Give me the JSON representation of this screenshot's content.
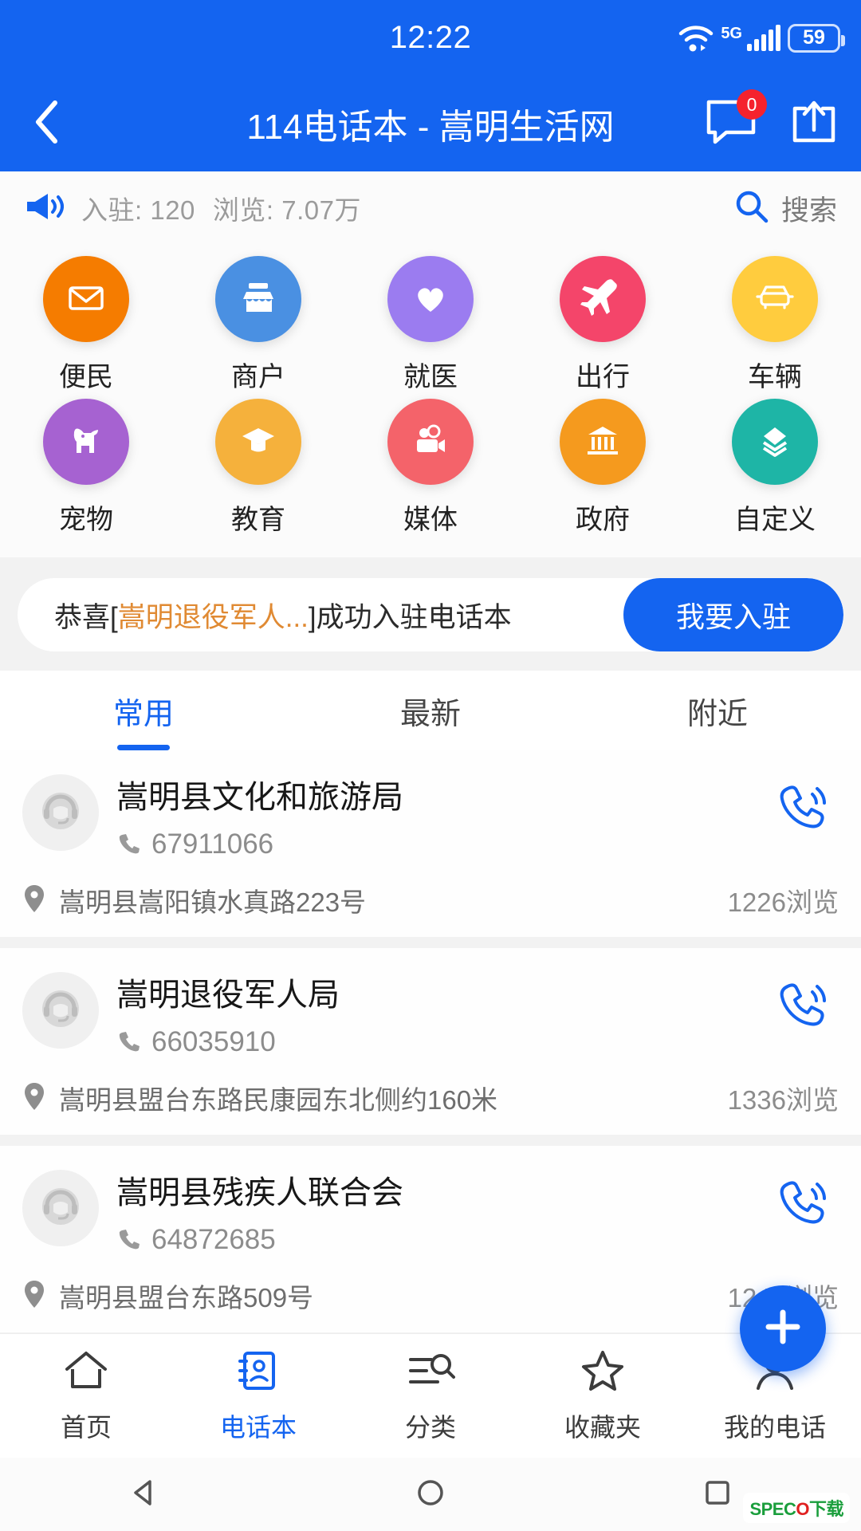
{
  "statusbar": {
    "time": "12:22",
    "network_label": "5G",
    "battery": "59",
    "wifi_icon": "wifi-icon",
    "signal_icon": "signal-bars-icon",
    "battery_icon": "battery-icon"
  },
  "navbar": {
    "title": "114电话本 - 嵩明生活网",
    "back_icon": "back-chevron-icon",
    "message_icon": "message-icon",
    "message_badge": "0",
    "share_icon": "share-icon"
  },
  "stats": {
    "megaphone_icon": "megaphone-icon",
    "entries_label": "入驻: 120",
    "views_label": "浏览: 7.07万",
    "search_label": "搜索",
    "search_icon": "search-icon"
  },
  "categories": [
    {
      "label": "便民",
      "color": "#f57c00",
      "icon": "envelope-icon"
    },
    {
      "label": "商户",
      "color": "#4a90e2",
      "icon": "shop-icon"
    },
    {
      "label": "就医",
      "color": "#9b7cf0",
      "icon": "heart-icon"
    },
    {
      "label": "出行",
      "color": "#f4456a",
      "icon": "airplane-icon"
    },
    {
      "label": "车辆",
      "color": "#ffcc3e",
      "icon": "car-icon"
    },
    {
      "label": "宠物",
      "color": "#a662d1",
      "icon": "dog-icon"
    },
    {
      "label": "教育",
      "color": "#f5b13c",
      "icon": "graduation-cap-icon"
    },
    {
      "label": "媒体",
      "color": "#f4636a",
      "icon": "video-camera-icon"
    },
    {
      "label": "政府",
      "color": "#f59a1e",
      "icon": "bank-icon"
    },
    {
      "label": "自定义",
      "color": "#1eb5a6",
      "icon": "layers-icon"
    }
  ],
  "notice": {
    "prefix": "恭喜[",
    "highlight": "嵩明退役军人...",
    "suffix": "]成功入驻电话本",
    "button_label": "我要入驻"
  },
  "tabs": [
    {
      "label": "常用",
      "active": true
    },
    {
      "label": "最新",
      "active": false
    },
    {
      "label": "附近",
      "active": false
    }
  ],
  "list": [
    {
      "name": "嵩明县文化和旅游局",
      "phone": "67911066",
      "address": "嵩明县嵩阳镇水真路223号",
      "views": "1226浏览",
      "avatar_icon": "headset-operator-icon",
      "call_icon": "phone-call-icon",
      "location_icon": "location-pin-icon",
      "phone_icon": "phone-handset-icon"
    },
    {
      "name": "嵩明退役军人局",
      "phone": "66035910",
      "address": "嵩明县盟台东路民康园东北侧约160米",
      "views": "1336浏览",
      "avatar_icon": "headset-operator-icon",
      "call_icon": "phone-call-icon",
      "location_icon": "location-pin-icon",
      "phone_icon": "phone-handset-icon"
    },
    {
      "name": "嵩明县残疾人联合会",
      "phone": "64872685",
      "address": "嵩明县盟台东路509号",
      "views": "1244浏览",
      "avatar_icon": "headset-operator-icon",
      "call_icon": "phone-call-icon",
      "location_icon": "location-pin-icon",
      "phone_icon": "phone-handset-icon"
    }
  ],
  "fab": {
    "icon": "plus-icon"
  },
  "bottomnav": [
    {
      "label": "首页",
      "icon": "home-icon",
      "active": false
    },
    {
      "label": "电话本",
      "icon": "contacts-icon",
      "active": true
    },
    {
      "label": "分类",
      "icon": "category-search-icon",
      "active": false
    },
    {
      "label": "收藏夹",
      "icon": "star-icon",
      "active": false
    },
    {
      "label": "我的电话",
      "icon": "person-icon",
      "active": false
    }
  ],
  "sysnav": {
    "back_icon": "triangle-back-icon",
    "home_icon": "circle-home-icon",
    "recents_icon": "square-recents-icon"
  },
  "watermark": {
    "brand": "SPEC",
    "brand_accent": "O",
    "suffix": "下载"
  },
  "colors": {
    "brand_blue": "#1464f0",
    "accent_orange": "#e08a33",
    "badge_red": "#f5222d"
  }
}
